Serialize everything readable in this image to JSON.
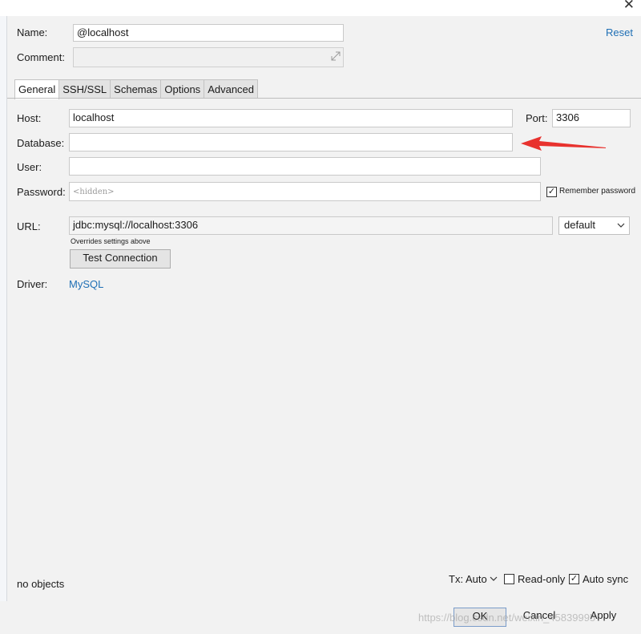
{
  "form": {
    "name_label": "Name:",
    "name_value": "@localhost",
    "reset_label": "Reset",
    "comment_label": "Comment:",
    "comment_value": ""
  },
  "tabs": [
    {
      "label": "General",
      "active": true
    },
    {
      "label": "SSH/SSL",
      "active": false
    },
    {
      "label": "Schemas",
      "active": false
    },
    {
      "label": "Options",
      "active": false
    },
    {
      "label": "Advanced",
      "active": false
    }
  ],
  "general": {
    "host_label": "Host:",
    "host_value": "localhost",
    "port_label": "Port:",
    "port_value": "3306",
    "database_label": "Database:",
    "database_value": "",
    "user_label": "User:",
    "user_value": "",
    "password_label": "Password:",
    "password_placeholder": "<hidden>",
    "remember_password_label": "Remember password",
    "remember_password_checked": true,
    "url_label": "URL:",
    "url_value": "jdbc:mysql://localhost:3306",
    "url_mode": "default",
    "url_hint": "Overrides settings above",
    "test_connection_label": "Test Connection",
    "driver_label": "Driver:",
    "driver_value": "MySQL"
  },
  "status": {
    "objects_text": "no objects",
    "tx_label": "Tx: Auto",
    "readonly_label": "Read-only",
    "readonly_checked": false,
    "autosync_label": "Auto sync",
    "autosync_checked": true
  },
  "footer": {
    "ok_label": "OK",
    "cancel_label": "Cancel",
    "apply_label": "Apply",
    "watermark": "https://blog.csdn.net/weixin_45839995"
  },
  "colors": {
    "annotation_arrow": "#e8322e",
    "link": "#1f6fb5"
  },
  "icons": {
    "close": "close-icon",
    "expand": "expand-icon",
    "dropdown": "chevron-down-icon",
    "arrow": "red-annotation-arrow"
  }
}
